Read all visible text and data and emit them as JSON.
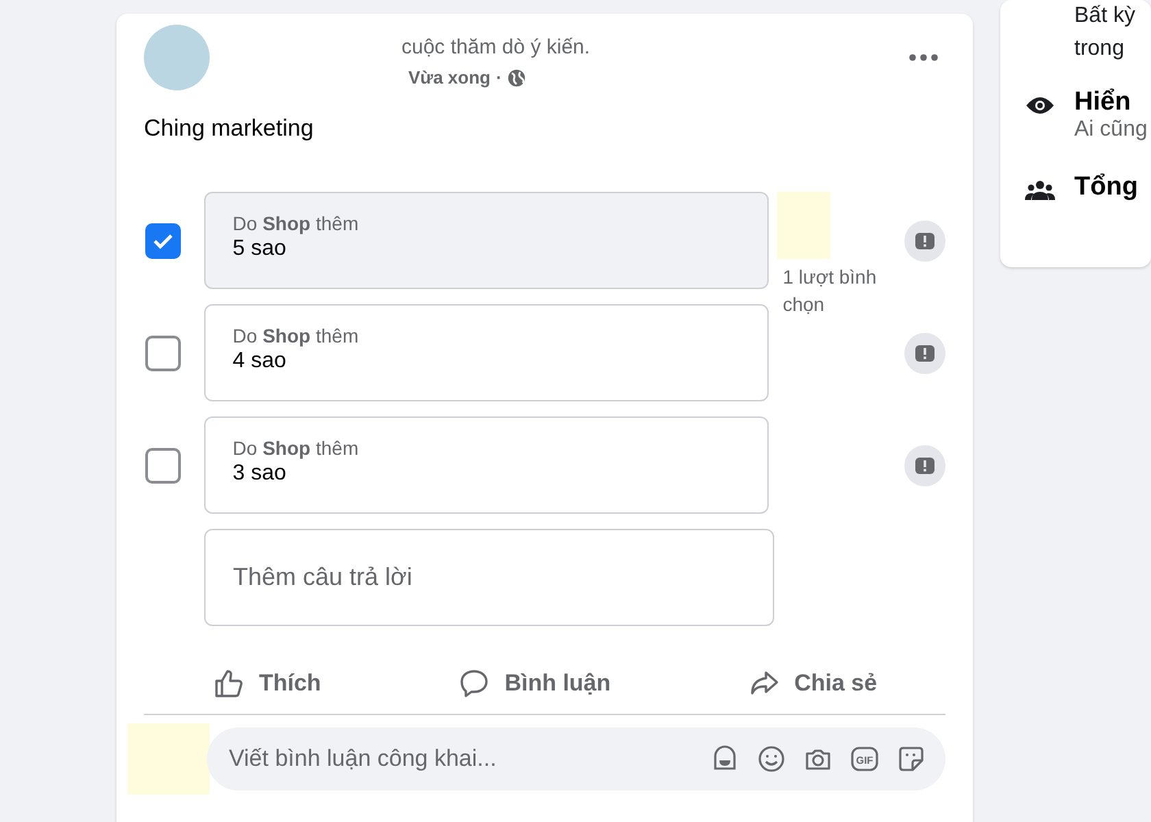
{
  "post": {
    "headline": "cuộc thăm dò ý kiến.",
    "time": "Vừa xong",
    "separator": "·",
    "question": "Ching marketing",
    "options": [
      {
        "added_by": "Do **Shop** thêm",
        "answer": "5 sao",
        "checked": true,
        "votes": "1 lượt bình chọn"
      },
      {
        "added_by": "Do **Shop** thêm",
        "answer": "4 sao",
        "checked": false
      },
      {
        "added_by": "Do **Shop** thêm",
        "answer": "3 sao",
        "checked": false
      }
    ],
    "add_answer": {
      "placeholder": "Thêm câu trả lời"
    },
    "actions": [
      {
        "kind": "like",
        "label": "Thích"
      },
      {
        "kind": "comment",
        "label": "Bình luận"
      },
      {
        "kind": "share",
        "label": "Chia sẻ"
      }
    ],
    "comment_box": {
      "placeholder": "Viết bình luận công khai...",
      "gif_label": "GIF"
    }
  },
  "side_panel": {
    "lines": [
      {
        "kind": "text",
        "text": "Bất kỳ"
      },
      {
        "kind": "text",
        "text": "trong"
      },
      {
        "kind": "eye",
        "title": "Hiển",
        "sub": "Ai cũng"
      },
      {
        "kind": "people",
        "title": "Tổng"
      }
    ]
  }
}
